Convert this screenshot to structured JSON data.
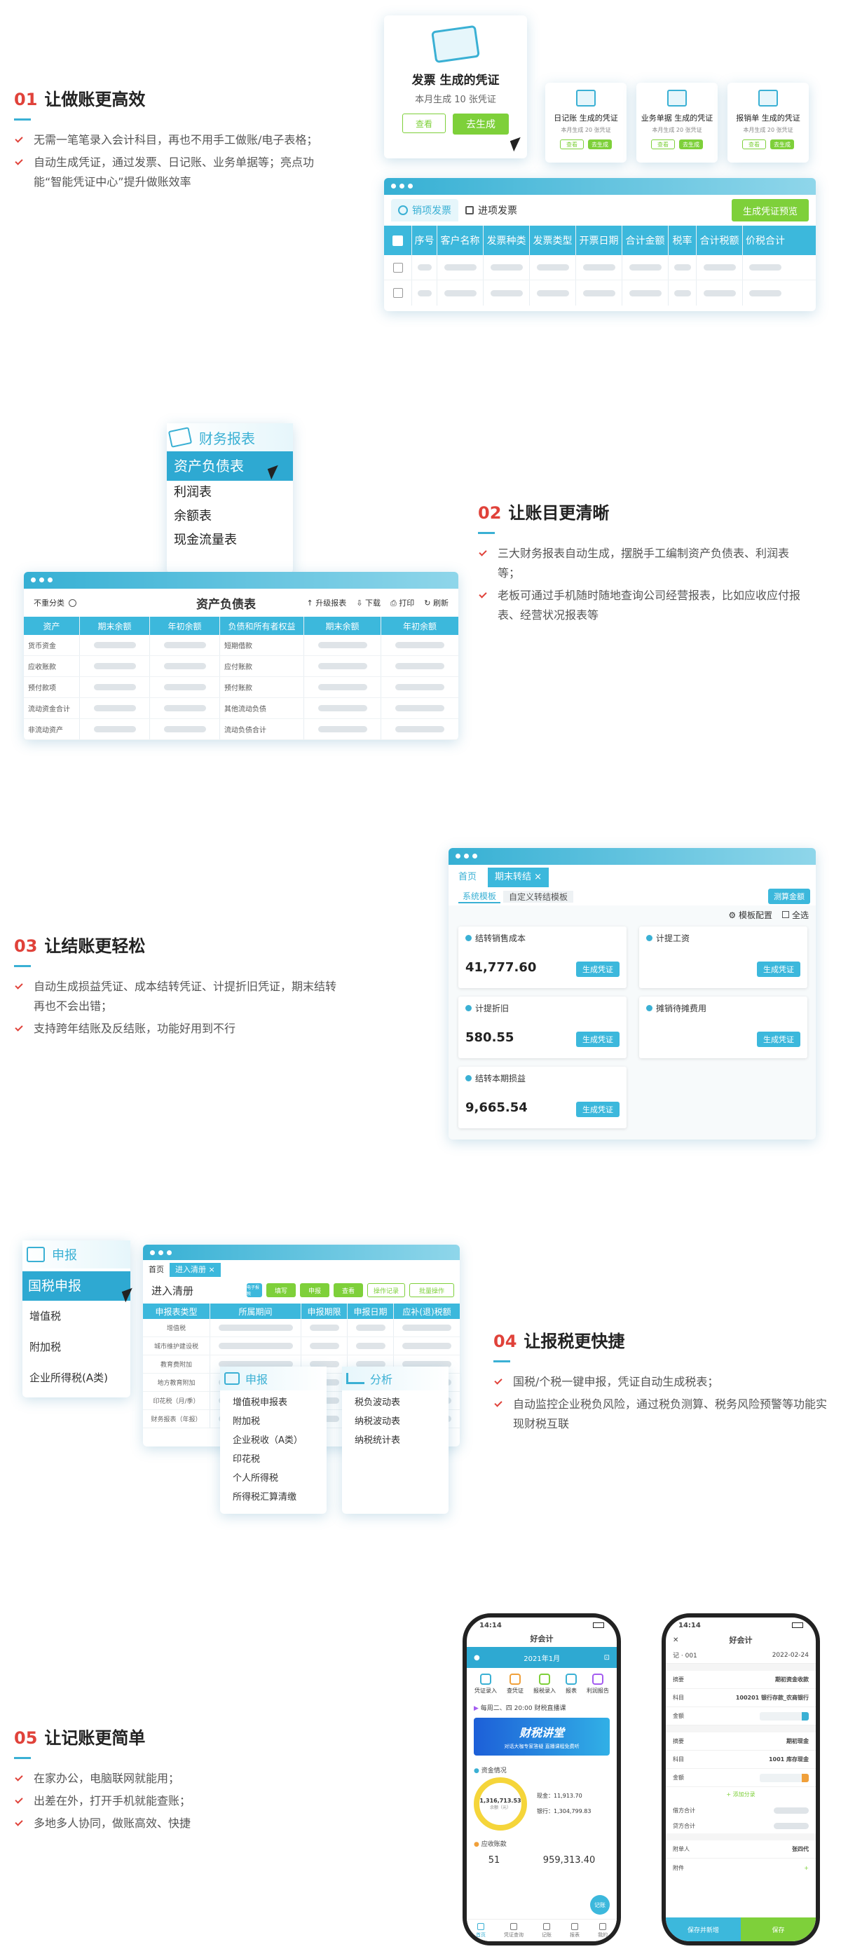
{
  "s1": {
    "num": "01",
    "title": "让做账更高效",
    "bullets": [
      "无需一笔笔录入会计科目，再也不用手工做账/电子表格；",
      "自动生成凭证，通过发票、日记账、业务单据等；亮点功能“智能凭证中心”提升做账效率"
    ]
  },
  "s1ui": {
    "main_title": "发票 生成的凭证",
    "main_sub": "本月生成 10 张凭证",
    "view": "查看",
    "generate": "去生成",
    "small_cards": [
      {
        "title": "日记账 生成的凭证",
        "sub": "本月生成 20 张凭证",
        "view": "查看",
        "gen": "去生成"
      },
      {
        "title": "业务单据 生成的凭证",
        "sub": "本月生成 20 张凭证",
        "view": "查看",
        "gen": "去生成"
      },
      {
        "title": "报销单 生成的凭证",
        "sub": "本月生成 20 张凭证",
        "view": "查看",
        "gen": "去生成"
      }
    ],
    "tab_sales": "销项发票",
    "tab_purchase": "进项发票",
    "preview_btn": "生成凭证预览",
    "columns": [
      "序号",
      "客户名称",
      "发票种类",
      "发票类型",
      "开票日期",
      "合计金额",
      "税率",
      "合计税额",
      "价税合计"
    ]
  },
  "s2": {
    "num": "02",
    "title": "让账目更清晰",
    "bullets": [
      "三大财务报表自动生成，摆脱手工编制资产负债表、利润表等；",
      "老板可通过手机随时随地查询公司经营报表，比如应收应付报表、经营状况报表等"
    ]
  },
  "s2ui": {
    "menu_title": "财务报表",
    "menu_items": [
      "资产负债表",
      "利润表",
      "余额表",
      "现金流量表"
    ],
    "filter": "不重分类",
    "table_title": "资产负债表",
    "actions": [
      "升级报表",
      "下载",
      "打印",
      "刷新"
    ],
    "columns": [
      "资产",
      "期末余额",
      "年初余额",
      "负债和所有者权益",
      "期末余额",
      "年初余额"
    ],
    "left_rows": [
      "货币资金",
      "应收账款",
      "预付款项",
      "流动资金合计",
      "非流动资产"
    ],
    "right_rows": [
      "短期借款",
      "应付账款",
      "预付账款",
      "其他流动负债",
      "流动负债合计"
    ]
  },
  "s3": {
    "num": "03",
    "title": "让结账更轻松",
    "bullets": [
      "自动生成损益凭证、成本结转凭证、计提折旧凭证，期末结转再也不会出错；",
      "支持跨年结账及反结账，功能好用到不行"
    ]
  },
  "s3ui": {
    "tab_home": "首页",
    "tab_close": "期末转结",
    "sub_sys": "系统模板",
    "sub_custom": "自定义转结模板",
    "calc_btn": "测算金额",
    "config": "模板配置",
    "select_all": "全选",
    "gen": "生成凭证",
    "cards": [
      {
        "title": "结转销售成本",
        "amount": "41,777.60"
      },
      {
        "title": "计提工资",
        "amount": ""
      },
      {
        "title": "计提折旧",
        "amount": "580.55"
      },
      {
        "title": "摊销待摊费用",
        "amount": ""
      },
      {
        "title": "结转本期损益",
        "amount": "9,665.54"
      }
    ]
  },
  "s4": {
    "num": "04",
    "title": "让报税更快捷",
    "bullets": [
      "国税/个税一键申报，凭证自动生成税表；",
      "自动监控企业税负风险，通过税负测算、税务风险预警等功能实现财税互联"
    ]
  },
  "s4ui": {
    "menu_title": "申报",
    "menu_items": [
      "国税申报",
      "增值税",
      "附加税",
      "企业所得税(A类)"
    ],
    "tab_home": "首页",
    "tab_clear": "进入清册",
    "page_title": "进入清册",
    "btns": [
      "填写",
      "申报",
      "查看",
      "操作记录",
      "批量操作"
    ],
    "small_btn": "电子报税",
    "columns": [
      "申报表类型",
      "所属期间",
      "申报期限",
      "申报日期",
      "应补(退)税额"
    ],
    "rows": [
      "增值税",
      "城市维护建设税",
      "教育费附加",
      "地方教育附加",
      "印花税（月/季）",
      "财务报表（年报）"
    ],
    "pop1_title": "申报",
    "pop1_items": [
      "增值税申报表",
      "附加税",
      "企业税收（A类）",
      "印花税",
      "个人所得税",
      "所得税汇算清缴"
    ],
    "pop2_title": "分析",
    "pop2_items": [
      "税负波动表",
      "纳税波动表",
      "纳税统计表"
    ]
  },
  "s5": {
    "num": "05",
    "title": "让记账更简单",
    "bullets": [
      "在家办公，电脑联网就能用；",
      "出差在外，打开手机就能查账；",
      "多地多人协同，做账高效、快捷"
    ]
  },
  "p1": {
    "time": "14:14",
    "app": "好会计",
    "period": "2021年1月",
    "icons": [
      "凭证录入",
      "查凭证",
      "报税录入",
      "报表",
      "利润报告"
    ],
    "notice": "每周二、四 20:00 财税直播课",
    "banner": "财税讲堂",
    "banner_sub": "对话大咖专家答疑 直播课程免费听",
    "funds_title": "资金情况",
    "ring_amount": "1,316,713.53",
    "ring_label": "余额（元）",
    "cash_label": "现金：",
    "cash": "11,913.70",
    "bank_label": "银行：",
    "bank": "1,304,799.83",
    "recv_title": "应收账款",
    "recv_count": "51",
    "recv_amount": "959,313.40",
    "tabs": [
      "首页",
      "凭证查询",
      "记账",
      "报表",
      "我的"
    ],
    "fab": "记账"
  },
  "p2": {
    "time": "14:14",
    "app": "好会计",
    "voucher": "记",
    "no": "001",
    "date": "2022-02-24",
    "summary_label": "摘要",
    "summary_value": "期初资金收款",
    "subject_label": "科目",
    "subject_value": "100201 银行存款_农商银行",
    "amount_label": "金额",
    "summary2_value": "期初现金",
    "subject2_value": "1001 库存现金",
    "add_entry": "+ 添加分录",
    "debit_label": "借方合计",
    "credit_label": "贷方合计",
    "attach_label": "附单人",
    "attach_value": "张四代",
    "files_label": "附件",
    "save_add": "保存并新增",
    "save": "保存"
  }
}
